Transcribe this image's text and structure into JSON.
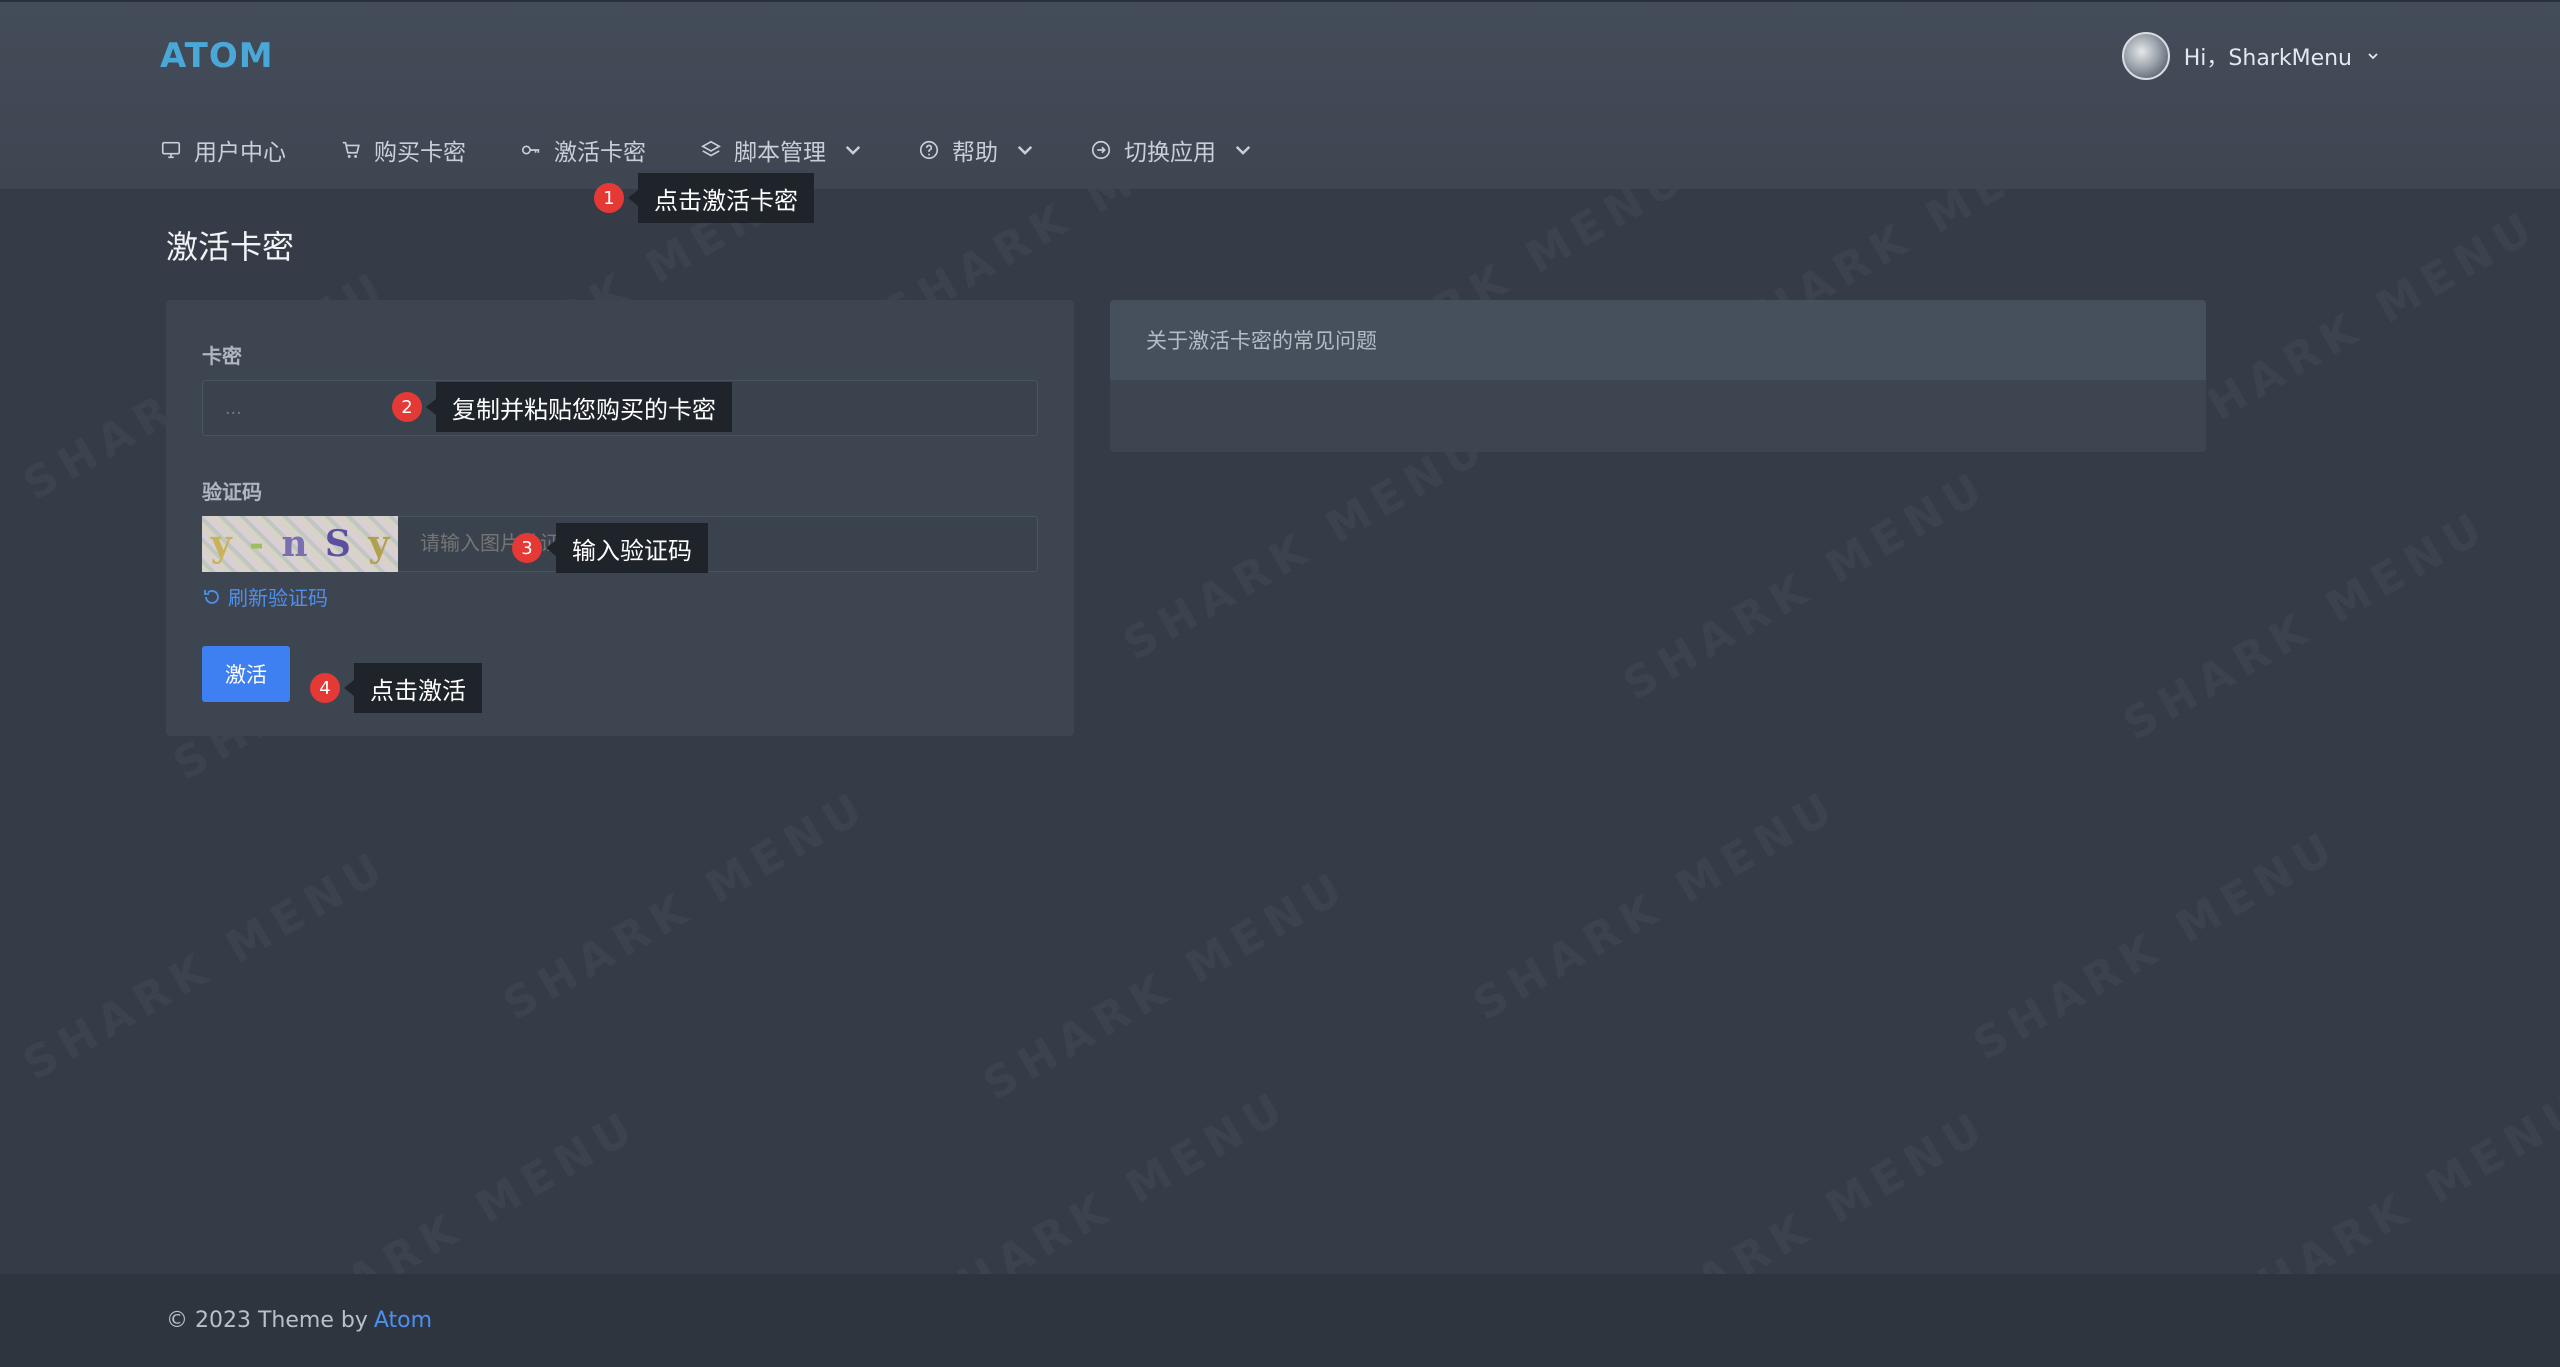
{
  "header": {
    "logo": "ATOM",
    "user_greeting": "Hi，SharkMenu"
  },
  "nav": {
    "items": [
      {
        "label": "用户中心",
        "icon": "monitor-icon"
      },
      {
        "label": "购买卡密",
        "icon": "cart-icon"
      },
      {
        "label": "激活卡密",
        "icon": "key-icon"
      },
      {
        "label": "脚本管理",
        "icon": "layers-icon",
        "dropdown": true
      },
      {
        "label": "帮助",
        "icon": "help-circle-icon",
        "dropdown": true
      },
      {
        "label": "切换应用",
        "icon": "arrow-circle-icon",
        "dropdown": true
      }
    ]
  },
  "page": {
    "title": "激活卡密"
  },
  "form": {
    "card_label": "卡密",
    "card_placeholder": "...",
    "captcha_label": "验证码",
    "captcha_text": [
      "y",
      "-",
      "n",
      "S",
      "y"
    ],
    "captcha_placeholder": "请输入图片验证码",
    "refresh_label": "刷新验证码",
    "submit_label": "激活"
  },
  "faq": {
    "title": "关于激活卡密的常见问题"
  },
  "annotations": [
    {
      "num": "1",
      "text": "点击激活卡密"
    },
    {
      "num": "2",
      "text": "复制并粘贴您购买的卡密"
    },
    {
      "num": "3",
      "text": "输入验证码"
    },
    {
      "num": "4",
      "text": "点击激活"
    }
  ],
  "watermark": "SHARK MENU",
  "footer": {
    "text": "© 2023 Theme by",
    "link": "Atom"
  },
  "colors": {
    "accent": "#3e7ff2",
    "logo": "#4aa8d8",
    "annotation_badge": "#e53935"
  }
}
